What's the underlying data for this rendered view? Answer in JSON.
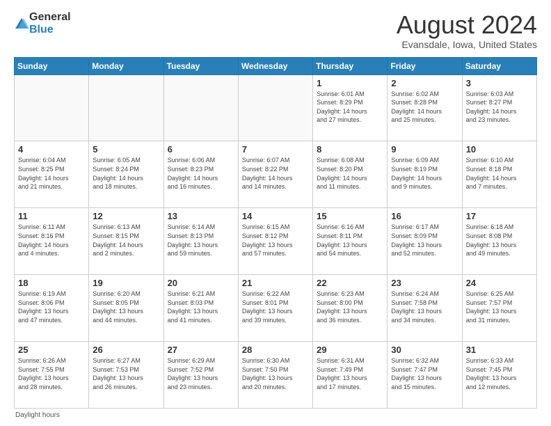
{
  "header": {
    "logo_general": "General",
    "logo_blue": "Blue",
    "month_title": "August 2024",
    "subtitle": "Evansdale, Iowa, United States"
  },
  "days_of_week": [
    "Sunday",
    "Monday",
    "Tuesday",
    "Wednesday",
    "Thursday",
    "Friday",
    "Saturday"
  ],
  "footer": {
    "daylight_label": "Daylight hours"
  },
  "weeks": [
    [
      {
        "day": "",
        "info": ""
      },
      {
        "day": "",
        "info": ""
      },
      {
        "day": "",
        "info": ""
      },
      {
        "day": "",
        "info": ""
      },
      {
        "day": "1",
        "info": "Sunrise: 6:01 AM\nSunset: 8:29 PM\nDaylight: 14 hours\nand 27 minutes."
      },
      {
        "day": "2",
        "info": "Sunrise: 6:02 AM\nSunset: 8:28 PM\nDaylight: 14 hours\nand 25 minutes."
      },
      {
        "day": "3",
        "info": "Sunrise: 6:03 AM\nSunset: 8:27 PM\nDaylight: 14 hours\nand 23 minutes."
      }
    ],
    [
      {
        "day": "4",
        "info": "Sunrise: 6:04 AM\nSunset: 8:25 PM\nDaylight: 14 hours\nand 21 minutes."
      },
      {
        "day": "5",
        "info": "Sunrise: 6:05 AM\nSunset: 8:24 PM\nDaylight: 14 hours\nand 18 minutes."
      },
      {
        "day": "6",
        "info": "Sunrise: 6:06 AM\nSunset: 8:23 PM\nDaylight: 14 hours\nand 16 minutes."
      },
      {
        "day": "7",
        "info": "Sunrise: 6:07 AM\nSunset: 8:22 PM\nDaylight: 14 hours\nand 14 minutes."
      },
      {
        "day": "8",
        "info": "Sunrise: 6:08 AM\nSunset: 8:20 PM\nDaylight: 14 hours\nand 11 minutes."
      },
      {
        "day": "9",
        "info": "Sunrise: 6:09 AM\nSunset: 8:19 PM\nDaylight: 14 hours\nand 9 minutes."
      },
      {
        "day": "10",
        "info": "Sunrise: 6:10 AM\nSunset: 8:18 PM\nDaylight: 14 hours\nand 7 minutes."
      }
    ],
    [
      {
        "day": "11",
        "info": "Sunrise: 6:11 AM\nSunset: 8:16 PM\nDaylight: 14 hours\nand 4 minutes."
      },
      {
        "day": "12",
        "info": "Sunrise: 6:13 AM\nSunset: 8:15 PM\nDaylight: 14 hours\nand 2 minutes."
      },
      {
        "day": "13",
        "info": "Sunrise: 6:14 AM\nSunset: 8:13 PM\nDaylight: 13 hours\nand 59 minutes."
      },
      {
        "day": "14",
        "info": "Sunrise: 6:15 AM\nSunset: 8:12 PM\nDaylight: 13 hours\nand 57 minutes."
      },
      {
        "day": "15",
        "info": "Sunrise: 6:16 AM\nSunset: 8:11 PM\nDaylight: 13 hours\nand 54 minutes."
      },
      {
        "day": "16",
        "info": "Sunrise: 6:17 AM\nSunset: 8:09 PM\nDaylight: 13 hours\nand 52 minutes."
      },
      {
        "day": "17",
        "info": "Sunrise: 6:18 AM\nSunset: 8:08 PM\nDaylight: 13 hours\nand 49 minutes."
      }
    ],
    [
      {
        "day": "18",
        "info": "Sunrise: 6:19 AM\nSunset: 8:06 PM\nDaylight: 13 hours\nand 47 minutes."
      },
      {
        "day": "19",
        "info": "Sunrise: 6:20 AM\nSunset: 8:05 PM\nDaylight: 13 hours\nand 44 minutes."
      },
      {
        "day": "20",
        "info": "Sunrise: 6:21 AM\nSunset: 8:03 PM\nDaylight: 13 hours\nand 41 minutes."
      },
      {
        "day": "21",
        "info": "Sunrise: 6:22 AM\nSunset: 8:01 PM\nDaylight: 13 hours\nand 39 minutes."
      },
      {
        "day": "22",
        "info": "Sunrise: 6:23 AM\nSunset: 8:00 PM\nDaylight: 13 hours\nand 36 minutes."
      },
      {
        "day": "23",
        "info": "Sunrise: 6:24 AM\nSunset: 7:58 PM\nDaylight: 13 hours\nand 34 minutes."
      },
      {
        "day": "24",
        "info": "Sunrise: 6:25 AM\nSunset: 7:57 PM\nDaylight: 13 hours\nand 31 minutes."
      }
    ],
    [
      {
        "day": "25",
        "info": "Sunrise: 6:26 AM\nSunset: 7:55 PM\nDaylight: 13 hours\nand 28 minutes."
      },
      {
        "day": "26",
        "info": "Sunrise: 6:27 AM\nSunset: 7:53 PM\nDaylight: 13 hours\nand 26 minutes."
      },
      {
        "day": "27",
        "info": "Sunrise: 6:29 AM\nSunset: 7:52 PM\nDaylight: 13 hours\nand 23 minutes."
      },
      {
        "day": "28",
        "info": "Sunrise: 6:30 AM\nSunset: 7:50 PM\nDaylight: 13 hours\nand 20 minutes."
      },
      {
        "day": "29",
        "info": "Sunrise: 6:31 AM\nSunset: 7:49 PM\nDaylight: 13 hours\nand 17 minutes."
      },
      {
        "day": "30",
        "info": "Sunrise: 6:32 AM\nSunset: 7:47 PM\nDaylight: 13 hours\nand 15 minutes."
      },
      {
        "day": "31",
        "info": "Sunrise: 6:33 AM\nSunset: 7:45 PM\nDaylight: 13 hours\nand 12 minutes."
      }
    ]
  ]
}
